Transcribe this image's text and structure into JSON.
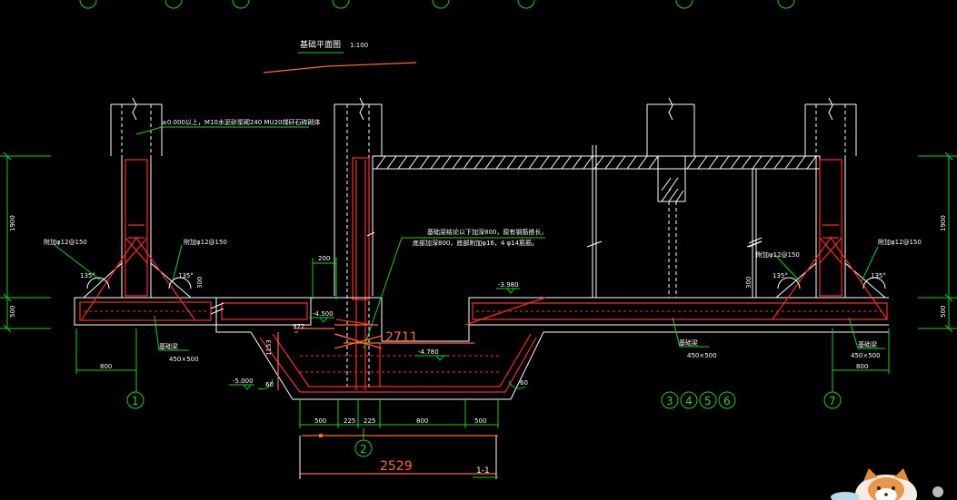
{
  "drawing": {
    "title": "基础平面图",
    "scale": "1:100",
    "notes": {
      "top_note": "±0.000以上，M10水泥砂浆砌240 MU20煤矸石砖砌体",
      "pit_note_line1": "基础梁结论以下加深800，原有钢筋搭长，",
      "pit_note_line2": "底部加深800，底部附加φ16，4 φ14筋筋。",
      "left_add_bar": "附加φ12@150",
      "left_add_bar2": "附加φ12@150",
      "right_add_bar": "附加φ12@150",
      "right_add_bar2": "附加φ12@150",
      "angle_135_a": "135°",
      "angle_135_b": "135°",
      "angle_135_c": "135°",
      "angle_135_d": "135°",
      "angle_60_left": "60",
      "angle_60_right": "60"
    },
    "beam_labels": {
      "left_name": "基础梁",
      "left_size": "450×500",
      "mid_name": "基础梁",
      "mid_size": "450×500",
      "right_name": "基础梁",
      "right_size": "450×500"
    },
    "elevations": {
      "e1": "-4.500",
      "e2": "-3.980",
      "e3": "-4.780",
      "e4": "-5.000"
    },
    "dimensions": {
      "left_height_upper": "1900",
      "left_height_lower": "500",
      "right_height_upper": "1900",
      "right_height_lower": "500",
      "right_inner_small": "300",
      "left_inner_small": "300",
      "left_width": "800",
      "right_width": "800",
      "pit_top": "200",
      "pit_depth": "1153",
      "pit_small": "972",
      "bottom": [
        "500",
        "225",
        "225",
        "800",
        "500"
      ],
      "orange_upper": "2711",
      "orange_lower": "2529"
    },
    "axes": {
      "a1": "1",
      "a2": "2",
      "a3": "3",
      "a4": "4",
      "a5": "5",
      "a6": "6",
      "a7": "7"
    },
    "section_label": "1-1"
  }
}
